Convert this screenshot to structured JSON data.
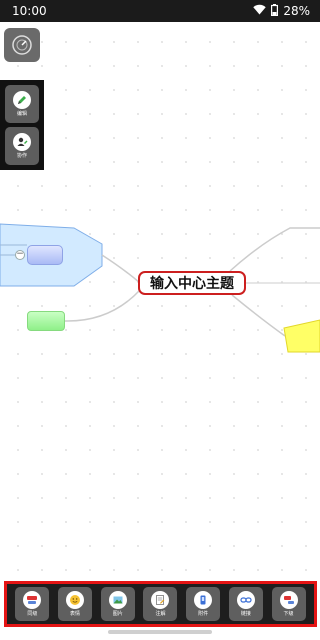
{
  "status_bar": {
    "time": "10:00",
    "battery": "28%"
  },
  "side_tools": [
    {
      "label": "编辑",
      "icon": "pencil-icon"
    },
    {
      "label": "协作",
      "icon": "user-edit-icon"
    }
  ],
  "mindmap": {
    "center_topic": "输入中心主题"
  },
  "toolbar": {
    "items": [
      {
        "label": "同级",
        "icon": "sibling-topic-icon"
      },
      {
        "label": "表情",
        "icon": "emoji-icon"
      },
      {
        "label": "图片",
        "icon": "image-icon"
      },
      {
        "label": "注解",
        "icon": "note-icon"
      },
      {
        "label": "附件",
        "icon": "attachment-icon"
      },
      {
        "label": "链接",
        "icon": "link-icon"
      },
      {
        "label": "下级",
        "icon": "child-topic-icon"
      }
    ]
  },
  "colors": {
    "center_border": "#cc1f1f",
    "toolbar_border": "#e41414",
    "left_branch": "#d2eaff",
    "right_branch": "#ffff66",
    "node_blue": "#a9baf5",
    "node_green": "#8ff089"
  }
}
